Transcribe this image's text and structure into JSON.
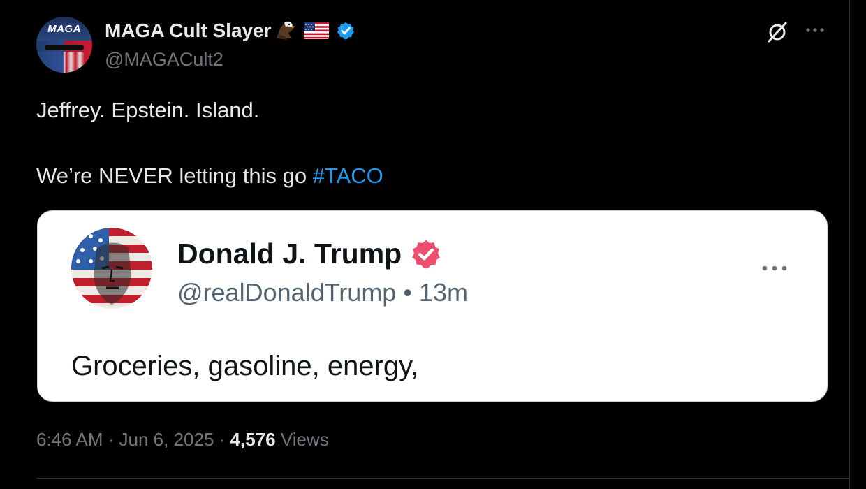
{
  "post": {
    "author_name": "MAGA Cult Slayer",
    "author_handle": "@MAGACult2",
    "avatar_cap_text": "MAGA",
    "text_line1": "Jeffrey. Epstein. Island.",
    "text_line2_prefix": "We’re NEVER letting this go ",
    "hashtag": "#TACO",
    "time": "6:46 AM",
    "separator": " · ",
    "date": "Jun 6, 2025",
    "views_count": "4,576",
    "views_label": " Views",
    "verified_color": "#1d9bf0"
  },
  "quote": {
    "author_name": "Donald J. Trump",
    "author_handle": "@realDonaldTrump",
    "bullet": " • ",
    "time_ago": "13m",
    "text": "Groceries, gasoline, energy,",
    "badge_color": "#ed4f6e"
  },
  "icons": {
    "top_right": [
      "grok-icon",
      "more-options-icon"
    ],
    "name_emojis": [
      "eagle-icon",
      "us-flag-icon",
      "verified-badge-icon"
    ]
  }
}
